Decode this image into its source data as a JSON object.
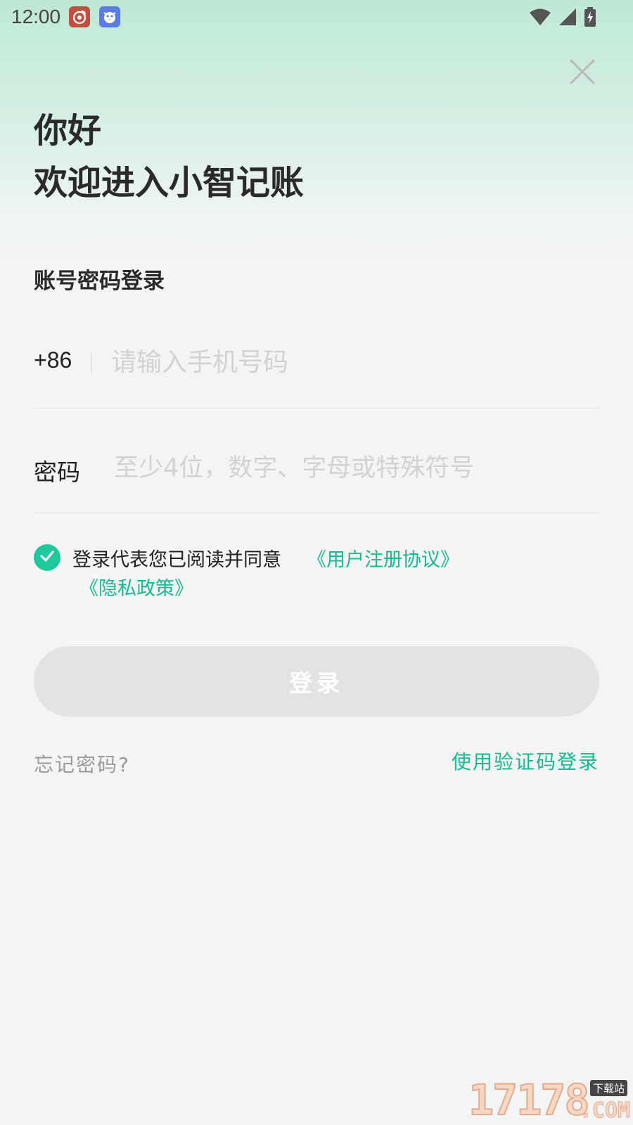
{
  "status_bar": {
    "time": "12:00",
    "notification_icons": [
      "weibo-icon",
      "bird-app-icon"
    ],
    "system_icons": [
      "wifi-icon",
      "cell-signal-icon",
      "battery-charging-icon"
    ]
  },
  "header": {
    "close_icon": "close-icon",
    "greeting": "你好",
    "welcome": "欢迎进入小智记账"
  },
  "login": {
    "section_title": "账号密码登录",
    "country_code": "+86",
    "phone_placeholder": "请输入手机号码",
    "phone_value": "",
    "password_label": "密码",
    "password_placeholder": "至少4位，数字、字母或特殊符号",
    "password_value": ""
  },
  "agreement": {
    "checked": true,
    "text": "登录代表您已阅读并同意",
    "user_agreement_link": "《用户注册协议》",
    "privacy_link": "《隐私政策》"
  },
  "actions": {
    "login_button": "登录",
    "forgot_password": "忘记密码?",
    "code_login": "使用验证码登录"
  },
  "watermark": {
    "digits": "17178",
    "tag": "下载站",
    "suffix": ".COM"
  },
  "colors": {
    "accent": "#17b992",
    "check_fill": "#1ec79c",
    "button_disabled": "#e3e3e3",
    "header_gradient_top": "#bfe8d6",
    "background": "#f4f4f4"
  }
}
